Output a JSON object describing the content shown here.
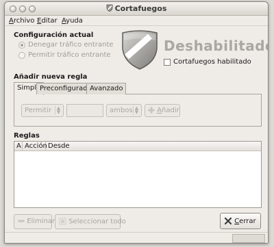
{
  "window": {
    "title": "Cortafuegos"
  },
  "menu": {
    "items": [
      {
        "label": "Archivo",
        "mnemonic": "A",
        "rest": "rchivo"
      },
      {
        "label": "Editar",
        "mnemonic": "E",
        "rest": "ditar"
      },
      {
        "label": "Ayuda",
        "mnemonic": "A",
        "rest": "yuda"
      }
    ]
  },
  "config": {
    "title": "Configuración actual",
    "options": [
      {
        "label": "Denegar tráfico entrante",
        "selected": true
      },
      {
        "label": "Permitir tráfico entrante",
        "selected": false
      }
    ]
  },
  "status": {
    "text": "Deshabilitado",
    "enable_checkbox_label": "Cortafuegos habilitado",
    "enabled": false
  },
  "add_rule": {
    "title": "Añadir nueva regla",
    "tabs": [
      {
        "label": "Simple",
        "active": true
      },
      {
        "label": "Preconfigurado",
        "active": false
      },
      {
        "label": "Avanzado",
        "active": false
      }
    ],
    "action_select": "Permitir",
    "direction_select": "ambos",
    "add_button": "Añadir",
    "add_button_mnemonic": "A",
    "add_button_rest": "ñadir"
  },
  "rules": {
    "title": "Reglas",
    "columns": [
      "A",
      "Acción",
      "Desde"
    ],
    "rows": []
  },
  "buttons": {
    "remove": "Eliminar",
    "select_all": "Seleccionar todo",
    "close": "Cerrar",
    "close_mnemonic": "C",
    "close_rest": "errar"
  },
  "icons": {
    "title": "shield-icon",
    "status": "shield-icon",
    "remove": "minus-icon",
    "select_all": "select-all-icon",
    "add": "plus-icon",
    "close": "close-x-icon"
  }
}
